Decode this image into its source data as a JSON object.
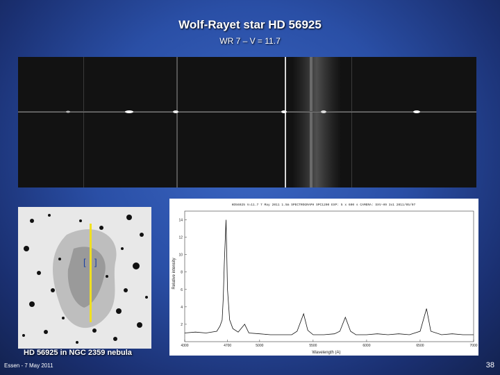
{
  "slide": {
    "title": "Wolf-Rayet star HD 56925",
    "subtitle": "WR 7 – V = 11.7",
    "caption": "HD 56925 in NGC 2359 nebula",
    "footer": "Essen - 7 May 2011",
    "page_number": "38",
    "background_color": "#2a4fa6"
  },
  "chart_data": {
    "type": "line",
    "header": "HD56925   V=11.7   7 May 2011   1.5m  SPECTROGRAPH   SPC1200   EXP: 5 x 600 s   CAMERA: SXV-H9   3x1   2011/05/07",
    "xlabel": "Wavelength (A)",
    "ylabel": "Relative intensity",
    "xlim": [
      4300,
      7000
    ],
    "ylim": [
      0,
      15
    ],
    "x_ticks": [
      "4300",
      "4700",
      "5000",
      "5500",
      "6000",
      "6500",
      "7000"
    ],
    "y_ticks": [
      "2",
      "4",
      "6",
      "8",
      "10",
      "12",
      "14"
    ],
    "series": [
      {
        "x": [
          4300,
          4400,
          4500,
          4600,
          4630,
          4650,
          4660,
          4670,
          4686,
          4700,
          4720,
          4750,
          4800,
          4860,
          4900,
          5000,
          5100,
          5200,
          5300,
          5350,
          5411,
          5450,
          5500,
          5600,
          5700,
          5750,
          5801,
          5850,
          5900,
          6000,
          6100,
          6200,
          6300,
          6400,
          6500,
          6560,
          6600,
          6700,
          6800,
          6900,
          7000
        ],
        "y": [
          1.0,
          1.1,
          1.0,
          1.2,
          1.8,
          2.5,
          5.0,
          9.0,
          14.0,
          6.0,
          2.5,
          1.5,
          1.1,
          2.0,
          1.0,
          0.9,
          0.8,
          0.8,
          0.8,
          1.2,
          3.2,
          1.3,
          0.8,
          0.8,
          0.9,
          1.2,
          2.8,
          1.2,
          0.8,
          0.8,
          0.9,
          0.8,
          0.9,
          0.8,
          1.2,
          3.8,
          1.2,
          0.8,
          0.9,
          0.8,
          0.8
        ]
      }
    ]
  }
}
